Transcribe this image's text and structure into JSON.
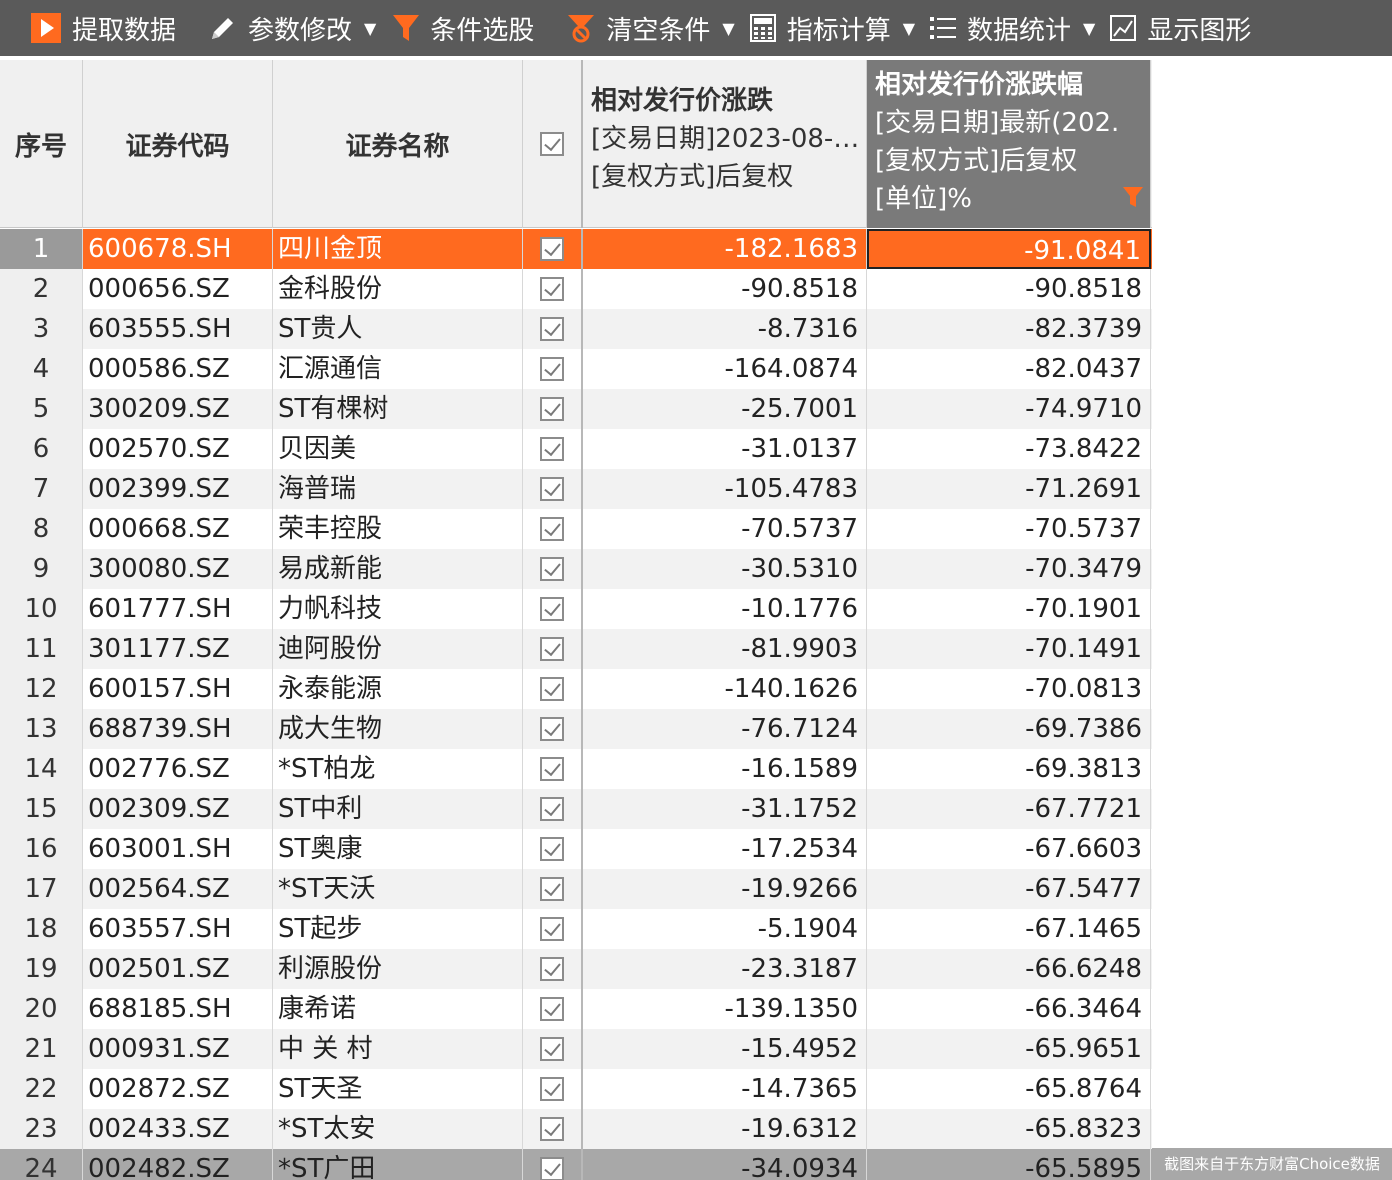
{
  "toolbar": {
    "items": [
      {
        "label": "提取数据",
        "icon": "play-icon",
        "color": "#ff6a1f"
      },
      {
        "label": "参数修改",
        "icon": "pencil-icon"
      },
      {
        "label": "条件选股",
        "icon": "filter-icon",
        "color": "#ff6a1f"
      },
      {
        "label": "清空条件",
        "icon": "clear-filter-icon",
        "color": "#ff6a1f"
      },
      {
        "label": "指标计算",
        "icon": "calculator-icon"
      },
      {
        "label": "数据统计",
        "icon": "list-icon"
      },
      {
        "label": "显示图形",
        "icon": "chart-icon"
      }
    ]
  },
  "table": {
    "headers": {
      "seq": "序号",
      "code": "证券代码",
      "name": "证券名称",
      "col1": {
        "title": "相对发行价涨跌",
        "line2": "[交易日期]2023-08-…",
        "line3": "[复权方式]后复权"
      },
      "col2": {
        "title": "相对发行价涨跌幅",
        "line2": "[交易日期]最新(202.",
        "line3": "[复权方式]后复权",
        "line4": "[单位]%"
      }
    },
    "rows": [
      {
        "seq": "1",
        "code": "600678.SH",
        "name": "四川金顶",
        "v1": "-182.1683",
        "v2": "-91.0841"
      },
      {
        "seq": "2",
        "code": "000656.SZ",
        "name": "金科股份",
        "v1": "-90.8518",
        "v2": "-90.8518"
      },
      {
        "seq": "3",
        "code": "603555.SH",
        "name": "ST贵人",
        "v1": "-8.7316",
        "v2": "-82.3739"
      },
      {
        "seq": "4",
        "code": "000586.SZ",
        "name": "汇源通信",
        "v1": "-164.0874",
        "v2": "-82.0437"
      },
      {
        "seq": "5",
        "code": "300209.SZ",
        "name": "ST有棵树",
        "v1": "-25.7001",
        "v2": "-74.9710"
      },
      {
        "seq": "6",
        "code": "002570.SZ",
        "name": "贝因美",
        "v1": "-31.0137",
        "v2": "-73.8422"
      },
      {
        "seq": "7",
        "code": "002399.SZ",
        "name": "海普瑞",
        "v1": "-105.4783",
        "v2": "-71.2691"
      },
      {
        "seq": "8",
        "code": "000668.SZ",
        "name": "荣丰控股",
        "v1": "-70.5737",
        "v2": "-70.5737"
      },
      {
        "seq": "9",
        "code": "300080.SZ",
        "name": "易成新能",
        "v1": "-30.5310",
        "v2": "-70.3479"
      },
      {
        "seq": "10",
        "code": "601777.SH",
        "name": "力帆科技",
        "v1": "-10.1776",
        "v2": "-70.1901"
      },
      {
        "seq": "11",
        "code": "301177.SZ",
        "name": "迪阿股份",
        "v1": "-81.9903",
        "v2": "-70.1491"
      },
      {
        "seq": "12",
        "code": "600157.SH",
        "name": "永泰能源",
        "v1": "-140.1626",
        "v2": "-70.0813"
      },
      {
        "seq": "13",
        "code": "688739.SH",
        "name": "成大生物",
        "v1": "-76.7124",
        "v2": "-69.7386"
      },
      {
        "seq": "14",
        "code": "002776.SZ",
        "name": "*ST柏龙",
        "v1": "-16.1589",
        "v2": "-69.3813"
      },
      {
        "seq": "15",
        "code": "002309.SZ",
        "name": "ST中利",
        "v1": "-31.1752",
        "v2": "-67.7721"
      },
      {
        "seq": "16",
        "code": "603001.SH",
        "name": "ST奥康",
        "v1": "-17.2534",
        "v2": "-67.6603"
      },
      {
        "seq": "17",
        "code": "002564.SZ",
        "name": "*ST天沃",
        "v1": "-19.9266",
        "v2": "-67.5477"
      },
      {
        "seq": "18",
        "code": "603557.SH",
        "name": "ST起步",
        "v1": "-5.1904",
        "v2": "-67.1465"
      },
      {
        "seq": "19",
        "code": "002501.SZ",
        "name": "利源股份",
        "v1": "-23.3187",
        "v2": "-66.6248"
      },
      {
        "seq": "20",
        "code": "688185.SH",
        "name": "康希诺",
        "v1": "-139.1350",
        "v2": "-66.3464"
      },
      {
        "seq": "21",
        "code": "000931.SZ",
        "name": "中 关 村",
        "v1": "-15.4952",
        "v2": "-65.9651"
      },
      {
        "seq": "22",
        "code": "002872.SZ",
        "name": "ST天圣",
        "v1": "-14.7365",
        "v2": "-65.8764"
      },
      {
        "seq": "23",
        "code": "002433.SZ",
        "name": "*ST太安",
        "v1": "-19.6312",
        "v2": "-65.8323"
      },
      {
        "seq": "24",
        "code": "002482.SZ",
        "name": "*ST广田",
        "v1": "-34.0934",
        "v2": "-65.5895"
      }
    ]
  },
  "watermark": "截图来自于东方财富Choice数据"
}
